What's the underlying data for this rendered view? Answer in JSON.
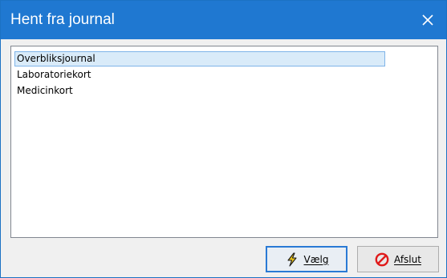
{
  "window": {
    "title": "Hent fra journal",
    "close_glyph": "✕"
  },
  "list": {
    "items": [
      {
        "label": "Overbliksjournal",
        "selected": true
      },
      {
        "label": "Laboratoriekort",
        "selected": false
      },
      {
        "label": "Medicinkort",
        "selected": false
      }
    ]
  },
  "buttons": {
    "select_label": "Vælg",
    "select_icon": "lightning-icon",
    "exit_label": "Afslut",
    "exit_icon": "no-entry-icon"
  },
  "colors": {
    "titlebar": "#1f78d1",
    "selection": "#d9ebf9",
    "exit_icon": "#e01b1b",
    "select_icon": "#e8c21a"
  }
}
